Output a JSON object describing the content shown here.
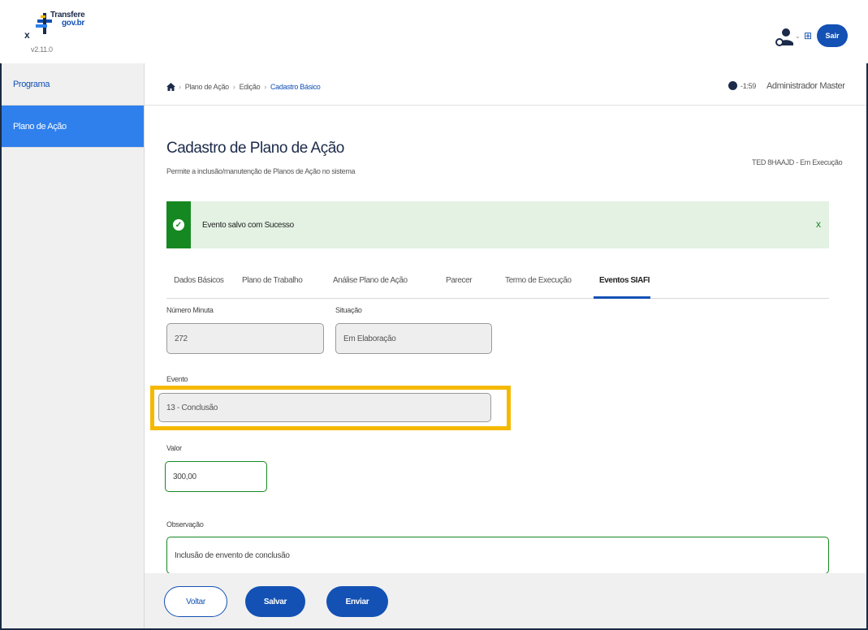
{
  "header": {
    "close_label": "x",
    "logo_line1": "Transfere",
    "logo_line2": "gov.br",
    "version": "v2.11.0",
    "exit_label": "Sair",
    "apps_glyph": "⊞",
    "chevron_glyph": "⌄"
  },
  "sidebar": {
    "items": [
      {
        "label": "Programa"
      },
      {
        "label": "Plano de Ação"
      }
    ]
  },
  "breadcrumb": {
    "items": [
      "Plano de Ação",
      "Edição",
      "Cadastro Básico"
    ],
    "separator": "›"
  },
  "session": {
    "timer": "-1:59",
    "user": "Administrador Master"
  },
  "page": {
    "title": "Cadastro de Plano de Ação",
    "subtitle": "Permite a inclusão/manutenção de Planos de Ação no sistema",
    "ted_status": "TED 8HAAJD - Em Execução"
  },
  "alert": {
    "message": "Evento salvo com Sucesso",
    "close": "x",
    "check": "✓"
  },
  "tabs": [
    {
      "label": "Dados Básicos"
    },
    {
      "label": "Plano de Trabalho"
    },
    {
      "label": "Análise Plano de Ação"
    },
    {
      "label": "Parecer"
    },
    {
      "label": "Termo de Execução"
    },
    {
      "label": "Eventos SIAFI"
    }
  ],
  "form": {
    "numero_minuta": {
      "label": "Número Minuta",
      "value": "272"
    },
    "situacao": {
      "label": "Situação",
      "value": "Em Elaboração"
    },
    "evento": {
      "label": "Evento",
      "value": "13 - Conclusão"
    },
    "valor": {
      "label": "Valor",
      "value": "300,00"
    },
    "observacao": {
      "label": "Observação",
      "value": "Inclusão de envento de conclusão"
    }
  },
  "actions": {
    "voltar": "Voltar",
    "salvar": "Salvar",
    "enviar": "Enviar"
  },
  "colors": {
    "primary": "#1351b4",
    "success": "#168821",
    "sidebar_active": "#2f80ed",
    "highlight": "#f5b800"
  }
}
